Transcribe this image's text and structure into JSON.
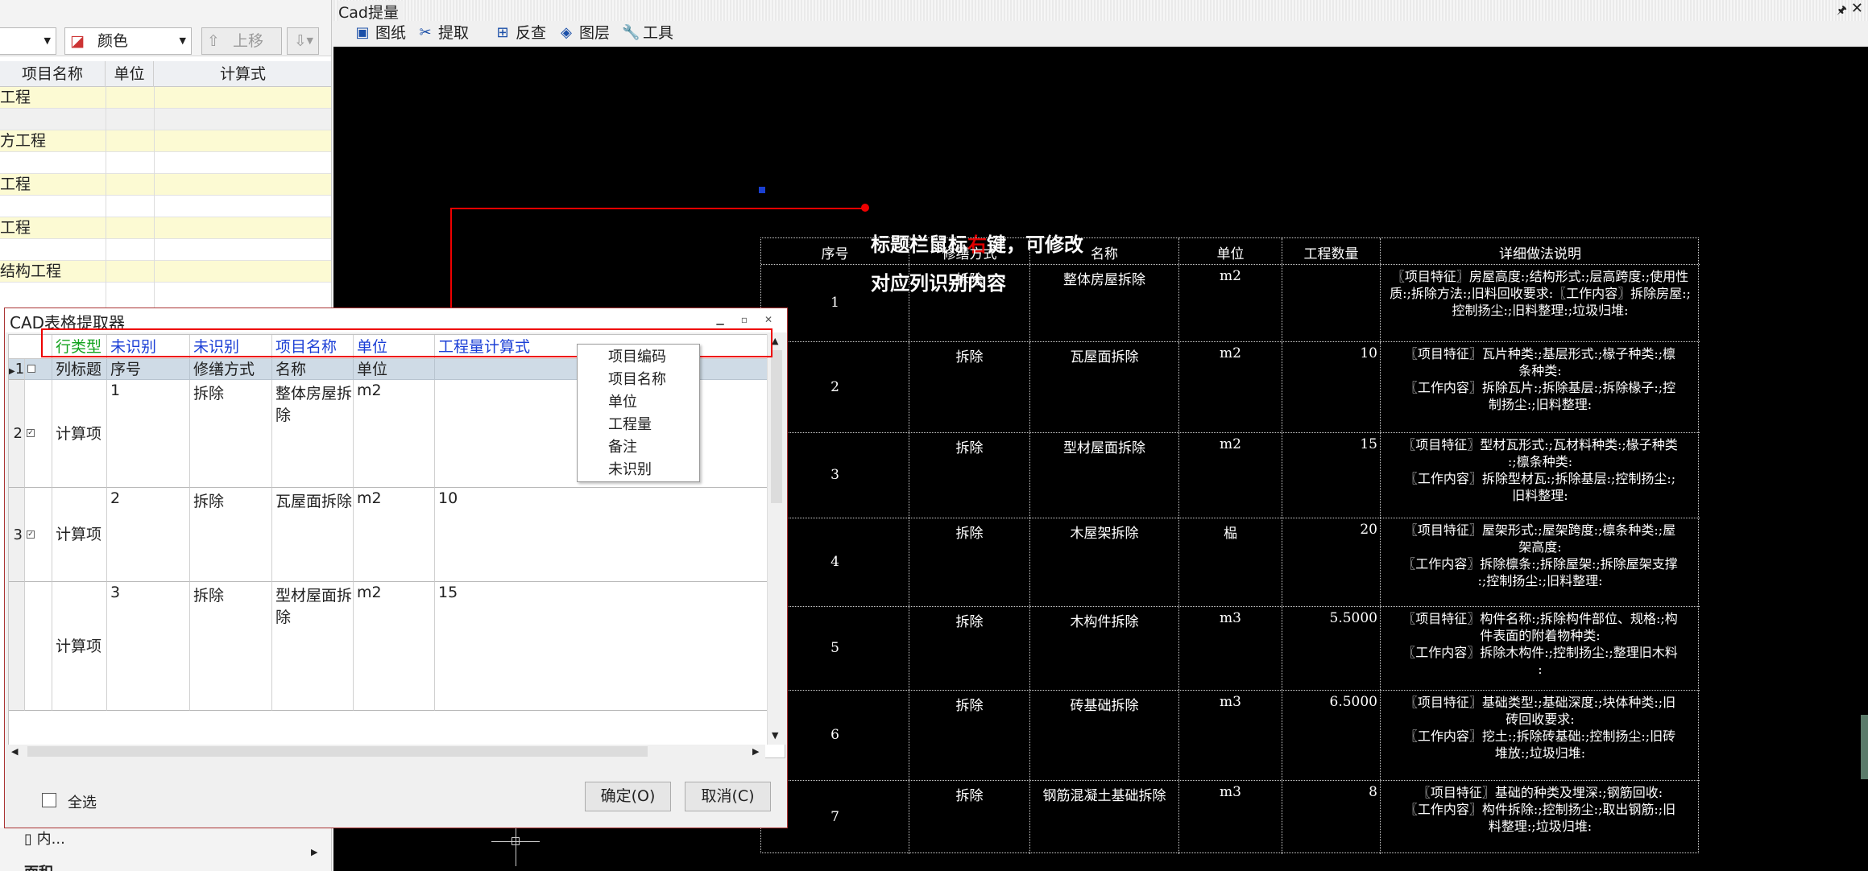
{
  "left_panel": {
    "dropdown1_value": "",
    "color_label": "颜色",
    "move_up_label": "上移",
    "headers": {
      "name": "项目名称",
      "unit": "单位",
      "formula": "计算式"
    },
    "rows": [
      {
        "name": "拆除工程"
      },
      {
        "name": ""
      },
      {
        "name": "土石方工程"
      },
      {
        "name": ""
      },
      {
        "name": "砌筑工程"
      },
      {
        "name": ""
      },
      {
        "name": "金属工程"
      },
      {
        "name": ""
      },
      {
        "name": "混凝土结构工程"
      }
    ],
    "bottom_item": "内...",
    "bottom_item2": "面积"
  },
  "cad": {
    "title": "Cad提量",
    "toolbar": [
      {
        "label": "图纸",
        "icon": "drawing-icon"
      },
      {
        "label": "提取",
        "icon": "extract-icon"
      },
      {
        "label": "反查",
        "icon": "reverse-lookup-icon"
      },
      {
        "label": "图层",
        "icon": "layers-icon"
      },
      {
        "label": "工具",
        "icon": "wrench-icon"
      }
    ],
    "annotation": {
      "line1_a": "标题栏鼠标",
      "line1_red": "右",
      "line1_b": "键，可修改",
      "line2": "对应列识别内容"
    },
    "table": {
      "headers": [
        "序号",
        "修缮方式",
        "名称",
        "单位",
        "工程数量",
        "详细做法说明"
      ],
      "rows": [
        {
          "no": "1",
          "method": "拆除",
          "name": "整体房屋拆除",
          "unit": "m2",
          "qty": "",
          "desc": [
            "〖项目特征〗房屋高度:;结构形式:;层高跨度:;使用性",
            "质:;拆除方法:;旧料回收要求:〖工作内容〗拆除房屋:;",
            "控制扬尘:;旧料整理:;垃圾归堆:"
          ]
        },
        {
          "no": "2",
          "method": "拆除",
          "name": "瓦屋面拆除",
          "unit": "m2",
          "qty": "10",
          "desc": [
            "〖项目特征〗瓦片种类:;基层形式:;椽子种类:;檩",
            "条种类:",
            "〖工作内容〗拆除瓦片:;拆除基层:;拆除椽子:;控",
            "制扬尘:;旧料整理:"
          ]
        },
        {
          "no": "3",
          "method": "拆除",
          "name": "型材屋面拆除",
          "unit": "m2",
          "qty": "15",
          "desc": [
            "〖项目特征〗型材瓦形式:;瓦材料种类:;椽子种类",
            ":;檩条种类:",
            "〖工作内容〗拆除型材瓦:;拆除基层:;控制扬尘:;",
            "旧料整理:"
          ]
        },
        {
          "no": "4",
          "method": "拆除",
          "name": "木屋架拆除",
          "unit": "榀",
          "qty": "20",
          "desc": [
            "〖项目特征〗屋架形式:;屋架跨度:;檩条种类:;屋",
            "架高度:",
            "〖工作内容〗拆除檩条:;拆除屋架:;拆除屋架支撑",
            ":;控制扬尘:;旧料整理:"
          ]
        },
        {
          "no": "5",
          "method": "拆除",
          "name": "木构件拆除",
          "unit": "m3",
          "qty": "5.5000",
          "desc": [
            "〖项目特征〗构件名称:;拆除构件部位、规格:;构",
            "件表面的附着物种类:",
            "〖工作内容〗拆除木构件:;控制扬尘:;整理旧木料",
            ":"
          ]
        },
        {
          "no": "6",
          "method": "拆除",
          "name": "砖基础拆除",
          "unit": "m3",
          "qty": "6.5000",
          "desc": [
            "〖项目特征〗基础类型:;基础深度:;块体种类:;旧",
            "砖回收要求:",
            "〖工作内容〗挖土:;拆除砖基础:;控制扬尘:;旧砖",
            "堆放:;垃圾归堆:"
          ]
        },
        {
          "no": "7",
          "method": "拆除",
          "name": "钢筋混凝土基础拆除",
          "unit": "m3",
          "qty": "8",
          "desc": [
            "〖项目特征〗基础的种类及埋深:;钢筋回收:",
            "〖工作内容〗构件拆除:;控制扬尘:;取出钢筋:;旧",
            "料整理:;垃圾归堆:"
          ]
        }
      ]
    }
  },
  "dialog": {
    "title": "CAD表格提取器",
    "headers": [
      "行类型",
      "未识别",
      "未识别",
      "项目名称",
      "单位",
      "工程量计算式"
    ],
    "title_row": {
      "num": "1",
      "type": "列标题",
      "c1": "序号",
      "c2": "修缮方式",
      "c3": "名称",
      "c4": "单位",
      "c5": ""
    },
    "rows": [
      {
        "num": "2",
        "checked": true,
        "type": "计算项",
        "c1": "1",
        "c2": "拆除",
        "c3": "整体房屋拆除",
        "c4": "m2",
        "c5": ""
      },
      {
        "num": "3",
        "checked": true,
        "type": "计算项",
        "c1": "2",
        "c2": "拆除",
        "c3": "瓦屋面拆除",
        "c4": "m2",
        "c5": "10"
      },
      {
        "num": "",
        "checked": false,
        "type": "计算项",
        "c1": "3",
        "c2": "拆除",
        "c3": "型材屋面拆除",
        "c4": "m2",
        "c5": "15"
      }
    ],
    "context_menu": [
      "项目编码",
      "项目名称",
      "单位",
      "工程量",
      "备注",
      "未识别"
    ],
    "select_all": "全选",
    "ok": "确定(O)",
    "cancel": "取消(C)"
  },
  "colors": {
    "accent_blue": "#1b3fd6",
    "green": "#14a31f",
    "highlight_red": "#e00000",
    "canvas": "#000000"
  }
}
